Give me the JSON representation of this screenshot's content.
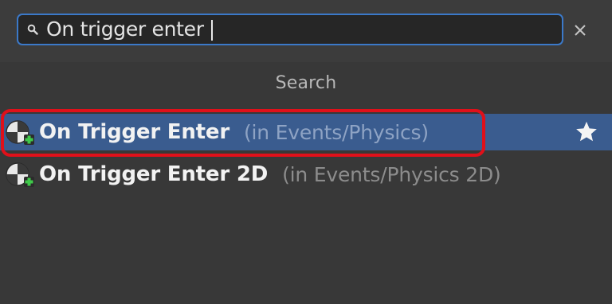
{
  "search": {
    "value": "On trigger enter",
    "clear_glyph": "×"
  },
  "section": {
    "title": "Search"
  },
  "results": [
    {
      "name": "On Trigger Enter",
      "path": "(in Events/Physics)",
      "selected": true,
      "favorite_icon": "star-icon"
    },
    {
      "name": "On Trigger Enter 2D",
      "path": "(in Events/Physics 2D)",
      "selected": false
    }
  ],
  "icons": {
    "search": "magnifier-icon",
    "node": "event-node-add-icon",
    "favorite": "star-icon",
    "clear": "close-icon"
  },
  "colors": {
    "accent_border": "#3b79c9",
    "selection": "#3a5c8f",
    "highlight": "#e0101a",
    "add_badge": "#3fc94a"
  }
}
